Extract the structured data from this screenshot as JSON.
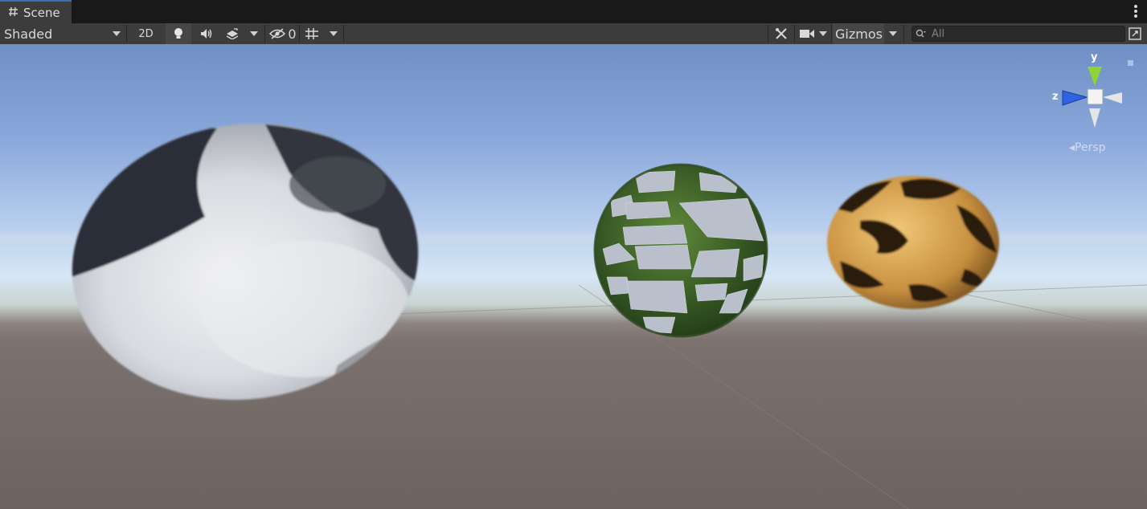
{
  "tab": {
    "title": "Scene",
    "icon": "grid-icon"
  },
  "toolbar": {
    "draw_mode": "Shaded",
    "mode_2d": "2D",
    "hidden_count": "0",
    "gizmos_label": "Gizmos"
  },
  "search": {
    "placeholder": "All",
    "value": ""
  },
  "gizmo": {
    "axis_y": "y",
    "axis_z": "z",
    "projection": "Persp"
  },
  "colors": {
    "accent": "#3a72b0",
    "axis_y": "#8fd336",
    "axis_z": "#2e63e3",
    "toolbar_bg": "#3c3c3c",
    "tab_bg": "#191919"
  },
  "scene": {
    "objects": [
      {
        "name": "panda-fur-sphere",
        "material": "black and white fur"
      },
      {
        "name": "stone-grass-sphere",
        "material": "cobblestone with grass"
      },
      {
        "name": "leopard-fur-sphere",
        "material": "leopard fur"
      }
    ]
  }
}
